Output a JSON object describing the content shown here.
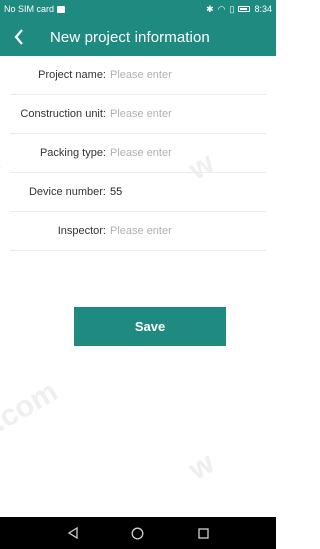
{
  "status_bar": {
    "carrier": "No SIM card",
    "time": "8:34"
  },
  "app_bar": {
    "title": "New project information"
  },
  "form": {
    "fields": [
      {
        "label": "Project name:",
        "value": "",
        "placeholder": "Please enter"
      },
      {
        "label": "Construction unit:",
        "value": "",
        "placeholder": "Please enter"
      },
      {
        "label": "Packing type:",
        "value": "",
        "placeholder": "Please enter"
      },
      {
        "label": "Device number:",
        "value": "55",
        "placeholder": ""
      },
      {
        "label": "Inspector:",
        "value": "",
        "placeholder": "Please enter"
      }
    ],
    "save_label": "Save"
  },
  "nav_bar": {
    "icons": [
      "back-triangle-icon",
      "home-circle-icon",
      "recents-square-icon"
    ]
  },
  "colors": {
    "accent": "#1f8a80"
  }
}
